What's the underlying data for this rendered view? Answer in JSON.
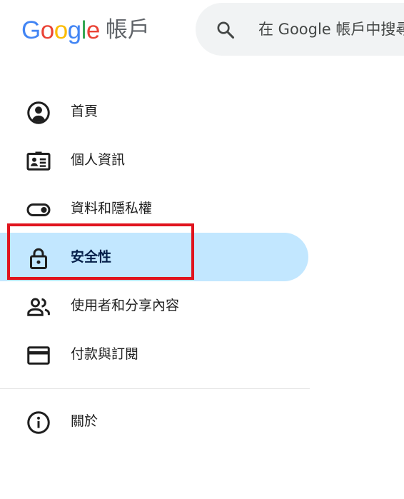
{
  "header": {
    "logo": {
      "letters": [
        {
          "char": "G",
          "color": "#4285F4"
        },
        {
          "char": "o",
          "color": "#EA4335"
        },
        {
          "char": "o",
          "color": "#FBBC05"
        },
        {
          "char": "g",
          "color": "#4285F4"
        },
        {
          "char": "l",
          "color": "#34A853"
        },
        {
          "char": "e",
          "color": "#EA4335"
        }
      ],
      "product": "帳戶"
    },
    "search": {
      "icon": "search-icon",
      "placeholder": "在 Google 帳戶中搜尋"
    }
  },
  "nav": {
    "items": [
      {
        "label": "首頁",
        "icon": "account-circle-icon",
        "active": false
      },
      {
        "label": "個人資訊",
        "icon": "id-card-icon",
        "active": false
      },
      {
        "label": "資料和隱私權",
        "icon": "toggle-icon",
        "active": false
      },
      {
        "label": "安全性",
        "icon": "lock-icon",
        "active": true
      },
      {
        "label": "使用者和分享內容",
        "icon": "people-icon",
        "active": false
      },
      {
        "label": "付款與訂閱",
        "icon": "credit-card-icon",
        "active": false
      }
    ],
    "footer_items": [
      {
        "label": "關於",
        "icon": "info-icon",
        "active": false
      }
    ]
  },
  "colors": {
    "active_bg": "#c2e7ff",
    "highlight_border": "#e0141e",
    "search_bg": "#f1f3f4"
  }
}
